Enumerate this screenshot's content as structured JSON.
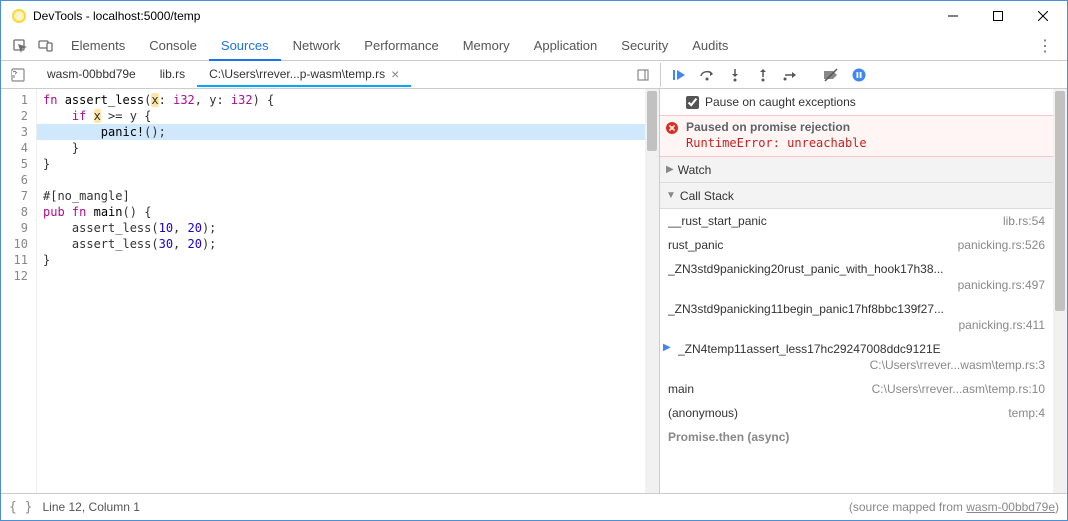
{
  "titlebar": {
    "title": "DevTools - localhost:5000/temp"
  },
  "panel_tabs": [
    "Elements",
    "Console",
    "Sources",
    "Network",
    "Performance",
    "Memory",
    "Application",
    "Security",
    "Audits"
  ],
  "active_panel": "Sources",
  "file_tabs": [
    {
      "label": "wasm-00bbd79e",
      "active": false,
      "closable": false
    },
    {
      "label": "lib.rs",
      "active": false,
      "closable": false
    },
    {
      "label": "C:\\Users\\rrever...p-wasm\\temp.rs",
      "active": true,
      "closable": true
    }
  ],
  "code_lines": [
    {
      "n": 1,
      "html": "<span class='kw'>fn</span> <span class='fn'>assert_less</span>(<span class='hl-token'>x</span>: <span class='ty'>i32</span>, y: <span class='ty'>i32</span>) {"
    },
    {
      "n": 2,
      "html": "    <span class='kw'>if</span> <span class='hl-token'>x</span> &gt;= y {"
    },
    {
      "n": 3,
      "html": "        <span class='mac'>panic!</span>();",
      "hl": true
    },
    {
      "n": 4,
      "html": "    }"
    },
    {
      "n": 5,
      "html": "}"
    },
    {
      "n": 6,
      "html": ""
    },
    {
      "n": 7,
      "html": "#[no_mangle]"
    },
    {
      "n": 8,
      "html": "<span class='kw'>pub</span> <span class='kw'>fn</span> <span class='fn'>main</span>() {"
    },
    {
      "n": 9,
      "html": "    assert_less(<span class='num'>10</span>, <span class='num'>20</span>);"
    },
    {
      "n": 10,
      "html": "    assert_less(<span class='num'>30</span>, <span class='num'>20</span>);"
    },
    {
      "n": 11,
      "html": "}"
    },
    {
      "n": 12,
      "html": ""
    }
  ],
  "pause_exceptions_label": "Pause on caught exceptions",
  "pause_exceptions_checked": true,
  "pause_banner": {
    "title": "Paused on promise rejection",
    "detail": "RuntimeError: unreachable"
  },
  "sections": {
    "watch": "Watch",
    "callstack": "Call Stack"
  },
  "call_stack": [
    {
      "func": "__rust_start_panic",
      "loc": "lib.rs:54"
    },
    {
      "func": "rust_panic",
      "loc": "panicking.rs:526"
    },
    {
      "func": "_ZN3std9panicking20rust_panic_with_hook17h38...",
      "loc": "panicking.rs:497",
      "two_line": true
    },
    {
      "func": "_ZN3std9panicking11begin_panic17hf8bbc139f27...",
      "loc": "panicking.rs:411",
      "two_line": true
    },
    {
      "func": "_ZN4temp11assert_less17hc29247008ddc9121E",
      "loc": "C:\\Users\\rrever...wasm\\temp.rs:3",
      "two_line": true,
      "active": true
    },
    {
      "func": "main",
      "loc": "C:\\Users\\rrever...asm\\temp.rs:10"
    },
    {
      "func": "(anonymous)",
      "loc": "temp:4"
    }
  ],
  "async_label": "Promise.then (async)",
  "statusbar": {
    "position": "Line 12, Column 1",
    "source_map_prefix": "(source mapped from ",
    "source_map_link": "wasm-00bbd79e",
    "source_map_suffix": ")"
  }
}
